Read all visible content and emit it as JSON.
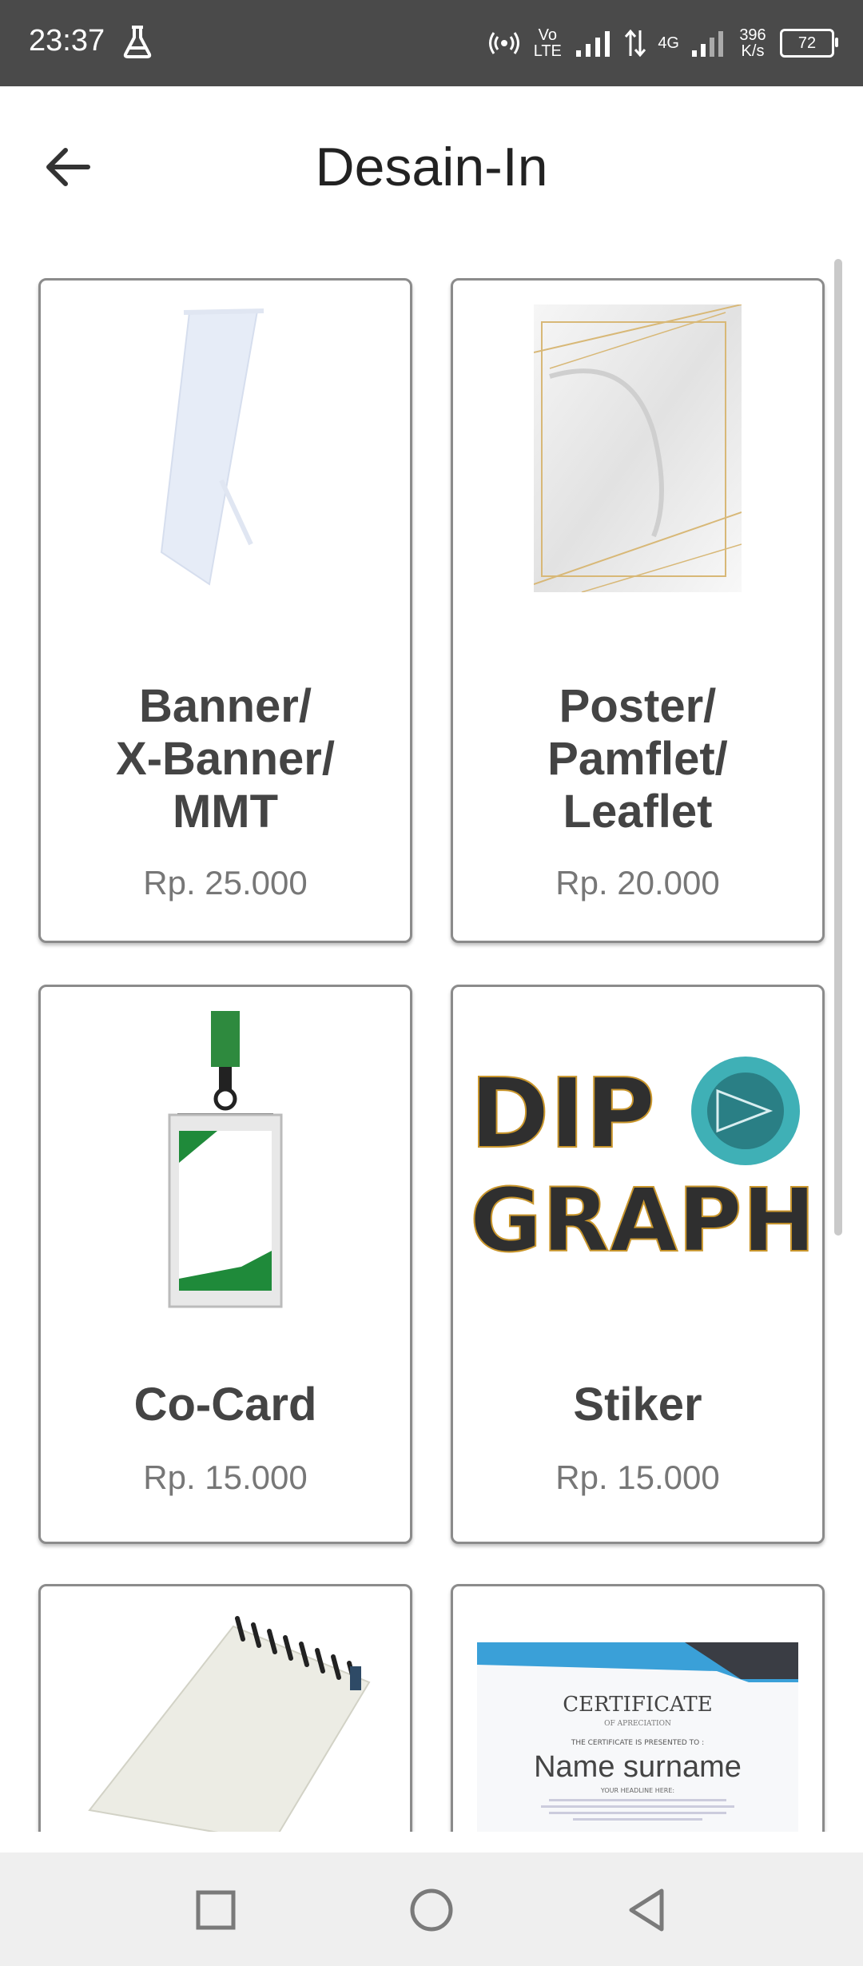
{
  "status": {
    "time": "23:37",
    "volte": "Vo LTE",
    "net": "4G",
    "speed": "396 K/s",
    "battery": "72"
  },
  "appbar": {
    "title": "Desain-In"
  },
  "products": [
    {
      "name": "Banner/\nX-Banner/\nMMT",
      "price": "Rp. 25.000"
    },
    {
      "name": "Poster/\nPamflet/\nLeaflet",
      "price": "Rp. 20.000"
    },
    {
      "name": "Co-Card",
      "price": "Rp. 15.000"
    },
    {
      "name": "Stiker",
      "price": "Rp. 15.000"
    },
    {
      "name": "",
      "price": ""
    },
    {
      "name": "",
      "price": ""
    }
  ],
  "images": {
    "dipograph_line1": "DIP",
    "dipograph_line2": "GRAPH",
    "cert_title": "CERTIFICATE",
    "cert_sub": "OF APRECIATION",
    "cert_presented": "THE CERTIFICATE IS PRESENTED TO :",
    "cert_name": "Name surname",
    "cert_headline": "YOUR HEADLINE HERE:"
  }
}
